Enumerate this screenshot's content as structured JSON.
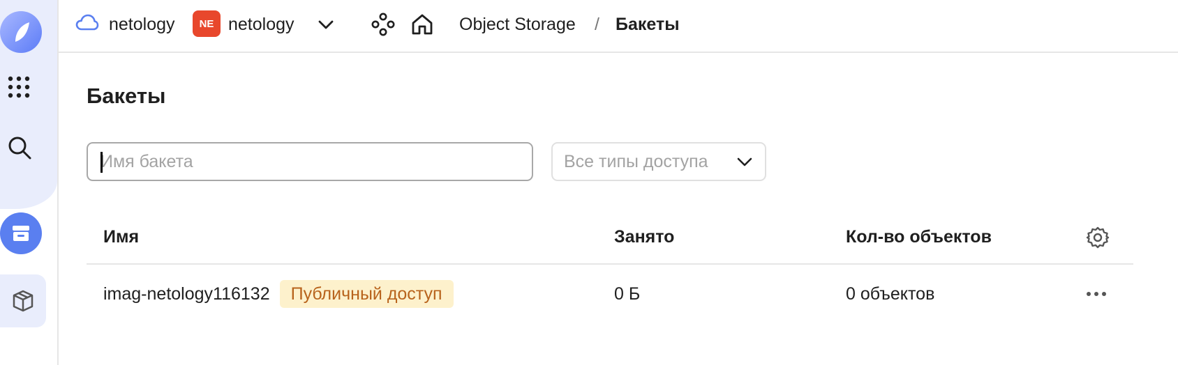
{
  "header": {
    "cloud_name": "netology",
    "folder_badge": "NE",
    "folder_name": "netology",
    "breadcrumb": {
      "service": "Object Storage",
      "separator": "/",
      "current": "Бакеты"
    }
  },
  "main": {
    "title": "Бакеты",
    "search": {
      "placeholder": "Имя бакета",
      "value": ""
    },
    "access_filter": {
      "selected": "Все типы доступа"
    }
  },
  "table": {
    "columns": [
      "Имя",
      "Занято",
      "Кол-во объектов"
    ],
    "rows": [
      {
        "name": "imag-netology116132",
        "access": "Публичный доступ",
        "size": "0 Б",
        "objects": "0 объектов"
      }
    ]
  },
  "colors": {
    "accent": "#5a7ff0",
    "folder_badge": "#e8472c",
    "badge_bg": "#fdf1cc",
    "badge_text": "#b8631c"
  },
  "icons": {
    "sidebar": [
      "logo-icon",
      "apps-grid-icon",
      "search-icon",
      "object-storage-icon",
      "cube-icon"
    ],
    "header": [
      "cloud-icon",
      "chevron-down-icon",
      "services-icon",
      "home-icon"
    ],
    "table": [
      "gear-icon",
      "more-icon"
    ]
  }
}
